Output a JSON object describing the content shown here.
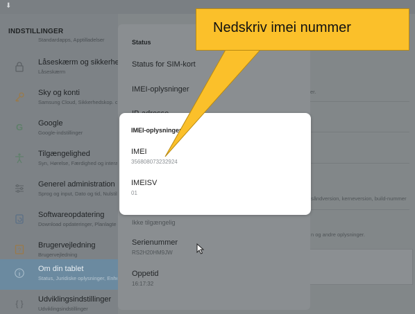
{
  "statusbar": {
    "download_icon": "download-icon"
  },
  "settings": {
    "header": "INDSTILLINGER",
    "nav": [
      {
        "partial_sub": "Standardapps, Apptilladelser",
        "icon": "apps-icon"
      },
      {
        "title": "Låseskærm og sikkerhed",
        "sub": "Låseskærm",
        "icon": "lock-icon"
      },
      {
        "title": "Sky og konti",
        "sub": "Samsung Cloud, Sikkerhedskop. og",
        "icon": "key-icon"
      },
      {
        "title": "Google",
        "sub": "Google-indstillinger",
        "icon": "google-icon"
      },
      {
        "title": "Tilgængelighed",
        "sub": "Syn, Hørelse, Færdighed og interak",
        "icon": "accessibility-icon"
      },
      {
        "title": "Generel administration",
        "sub": "Sprog og input, Dato og tid, Nulstil",
        "icon": "sliders-icon"
      },
      {
        "title": "Softwareopdatering",
        "sub": "Download opdateringer, Planlagte s",
        "icon": "update-icon"
      },
      {
        "title": "Brugervejledning",
        "sub": "Brugervejledning",
        "icon": "help-icon"
      },
      {
        "title": "Om din tablet",
        "sub": "Status, Juridiske oplysninger, Enhe",
        "icon": "info-icon"
      },
      {
        "title": "Udviklingsindstillinger",
        "sub": "Udviklingsindstillinger",
        "icon": "code-braces-icon"
      }
    ],
    "right": {
      "text1": "er.",
      "text2": "såndversion, kerneversion, build-nummer",
      "text3": "n og andre oplysninger."
    }
  },
  "status_panel": {
    "title": "Status",
    "items": [
      "Status for SIM-kort",
      "IMEI-oplysninger",
      "IP-adresse"
    ],
    "hidden_value": "Ikke tilgængelig",
    "serial_label": "Serienummer",
    "serial_value": "RS2H20HM9JW",
    "uptime_label": "Oppetid",
    "uptime_value": "16:17:32"
  },
  "dialog": {
    "title": "IMEI-oplysninger",
    "imei_label": "IMEI",
    "imei_value": "356808073232924",
    "imeisv_label": "IMEISV",
    "imeisv_value": "01"
  },
  "callout": {
    "text": "Nedskriv imei nummer",
    "color": "#fbc02a"
  }
}
